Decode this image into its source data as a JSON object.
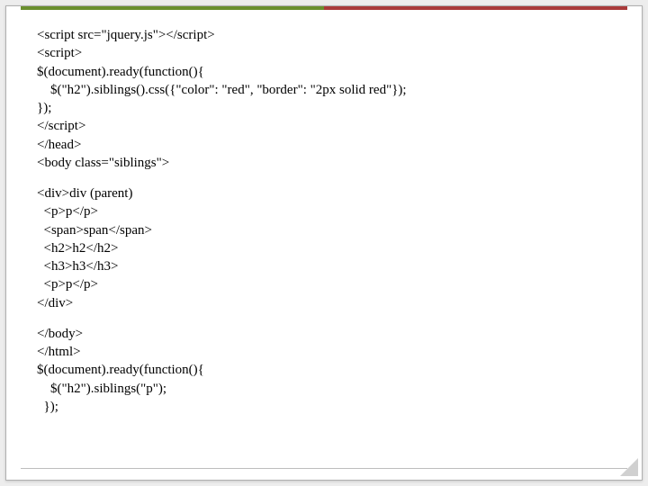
{
  "code": {
    "block1": [
      "<script src=\"jquery.js\"></script>",
      "<script>",
      "$(document).ready(function(){",
      "    $(\"h2\").siblings().css({\"color\": \"red\", \"border\": \"2px solid red\"});",
      "});",
      "</script>",
      "</head>",
      "<body class=\"siblings\">"
    ],
    "block2": [
      "<div>div (parent)",
      "  <p>p</p>",
      "  <span>span</span>",
      "  <h2>h2</h2>",
      "  <h3>h3</h3>",
      "  <p>p</p>",
      "</div>"
    ],
    "block3": [
      "</body>",
      "</html>",
      "$(document).ready(function(){",
      "    $(\"h2\").siblings(\"p\");",
      "  });"
    ]
  }
}
